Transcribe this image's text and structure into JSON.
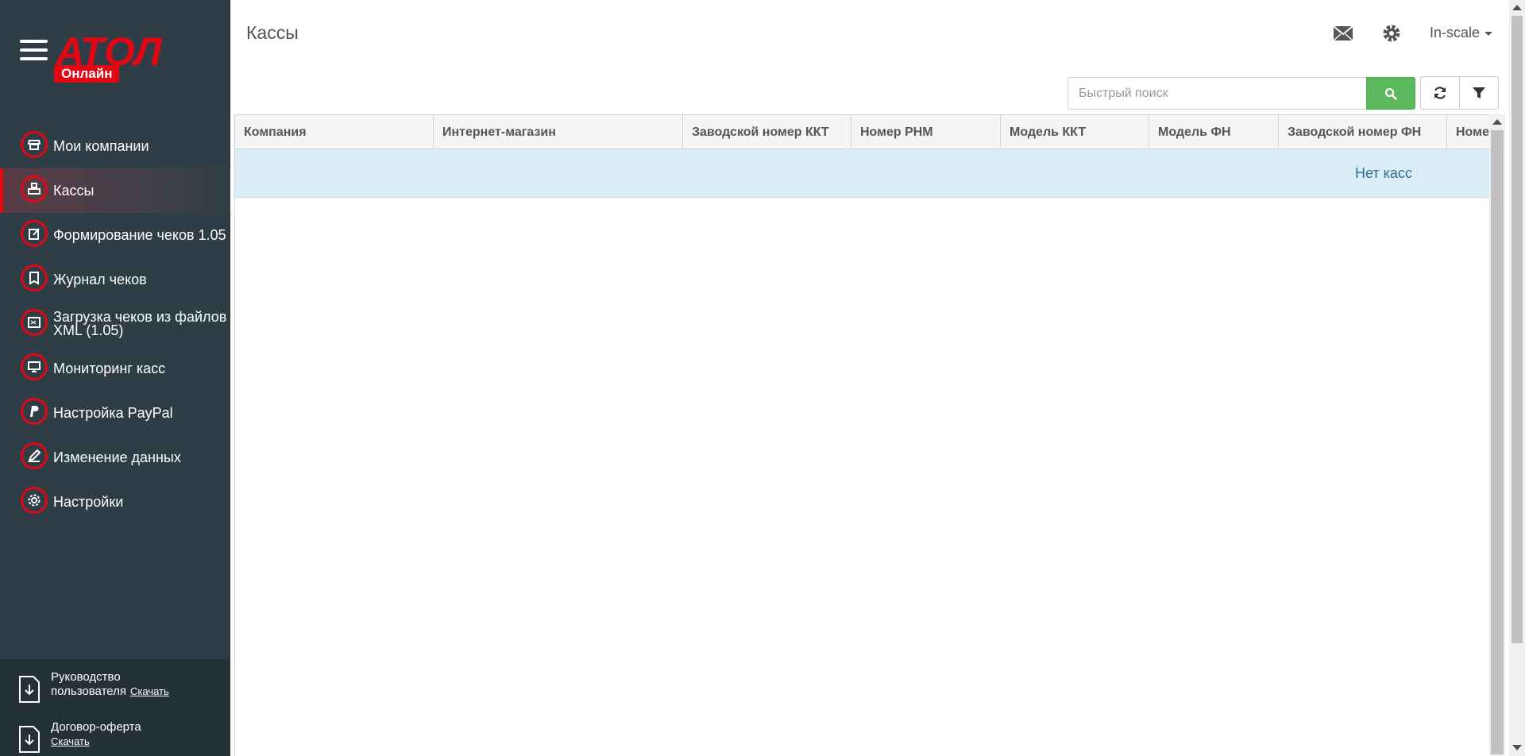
{
  "brand": {
    "logo_text": "АТОЛ",
    "logo_sub": "Онлайн",
    "accent_color": "#e30613",
    "sidebar_color": "#2f3e46"
  },
  "sidebar": {
    "items": [
      {
        "label": "Мои компании",
        "icon": "store-icon",
        "active": false
      },
      {
        "label": "Кассы",
        "icon": "cash-register-icon",
        "active": true
      },
      {
        "label": "Формирование чеков 1.05",
        "icon": "receipt-edit-icon",
        "active": false
      },
      {
        "label": "Журнал чеков",
        "icon": "book-icon",
        "active": false
      },
      {
        "label": "Загрузка чеков из файлов XML (1.05)",
        "icon": "xml-file-icon",
        "active": false
      },
      {
        "label": "Мониторинг касс",
        "icon": "monitor-icon",
        "active": false
      },
      {
        "label": "Настройка PayPal",
        "icon": "paypal-icon",
        "active": false
      },
      {
        "label": "Изменение данных",
        "icon": "pencil-icon",
        "active": false
      },
      {
        "label": "Настройки",
        "icon": "gear-icon",
        "active": false
      }
    ],
    "docs": [
      {
        "title_line1": "Руководство",
        "title_line2": "пользователя",
        "link": "Скачать"
      },
      {
        "title_line1": "Договор-оферта",
        "link": "Скачать"
      }
    ]
  },
  "header": {
    "title": "Кассы",
    "user": "In-scale",
    "icons": [
      "mail-icon",
      "gear-icon"
    ]
  },
  "toolbar": {
    "search_placeholder": "Быстрый поиск",
    "search_icon": "search-icon",
    "refresh_icon": "refresh-icon",
    "filter_icon": "filter-icon"
  },
  "grid": {
    "columns": [
      "Компания",
      "Интернет-магазин",
      "Заводской номер ККТ",
      "Номер РНМ",
      "Модель ККТ",
      "Модель ФН",
      "Заводской номер ФН",
      "Номер ФН"
    ],
    "empty_message": "Нет касс"
  }
}
